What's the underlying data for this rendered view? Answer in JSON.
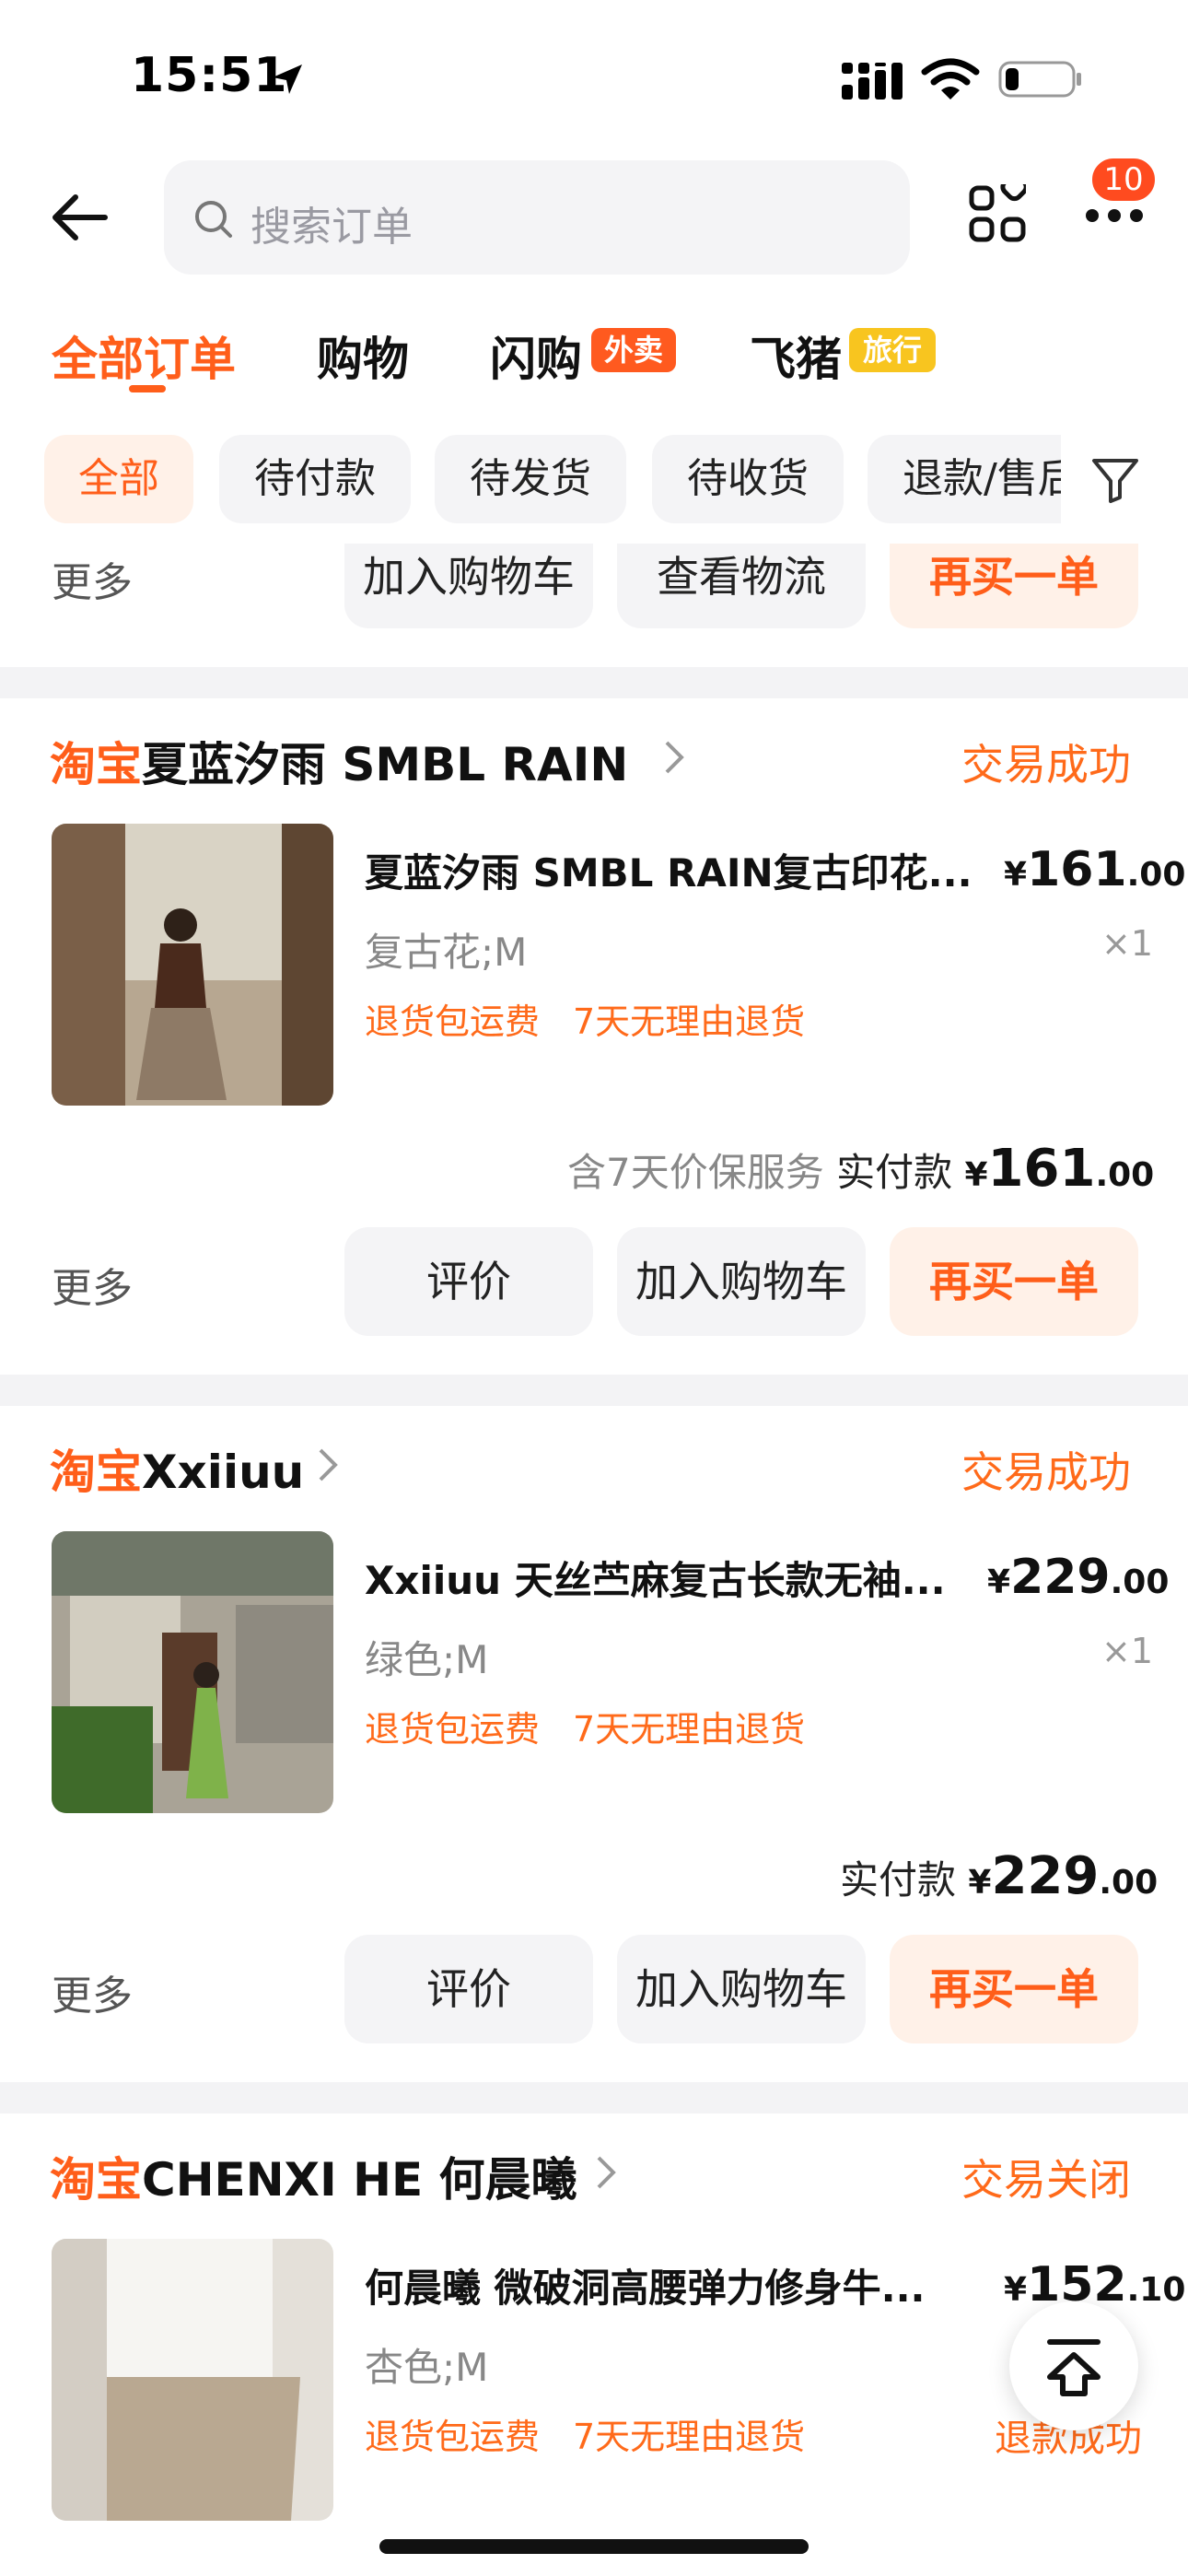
{
  "status_bar": {
    "time": "15:51"
  },
  "header": {
    "search_placeholder": "搜索订单",
    "badge_count": "10"
  },
  "tabs": [
    {
      "label": "全部订单",
      "active": true
    },
    {
      "label": "购物"
    },
    {
      "label": "闪购",
      "tag": "外卖"
    },
    {
      "label": "飞猪",
      "tag": "旅行"
    }
  ],
  "filters": [
    "全部",
    "待付款",
    "待发货",
    "待收货",
    "退款/售后"
  ],
  "prev_card": {
    "more": "更多",
    "buttons": [
      "加入购物车",
      "查看物流",
      "再买一单"
    ]
  },
  "orders": [
    {
      "platform": "淘宝",
      "shop": "夏蓝汐雨 SMBL RAIN",
      "status": "交易成功",
      "title": "夏蓝汐雨 SMBL RAIN复古印花...",
      "price_symbol": "¥",
      "price_int": "161",
      "price_dec": ".00",
      "variant": "复古花;M",
      "qty": "×1",
      "guarantees": [
        "退货包运费",
        "7天无理由退货"
      ],
      "extra_service": "含7天价保服务",
      "paid_label": "实付款",
      "paid_int": "161",
      "paid_dec": ".00",
      "more": "更多",
      "buttons": [
        "评价",
        "加入购物车",
        "再买一单"
      ],
      "thumb_colors": [
        "#7a5f48",
        "#c9b9a3",
        "#5a3a2a"
      ]
    },
    {
      "platform": "淘宝",
      "shop": "Xxiiuu",
      "status": "交易成功",
      "title": "Xxiiuu 天丝苎麻复古长款无袖...",
      "price_symbol": "¥",
      "price_int": "229",
      "price_dec": ".00",
      "variant": "绿色;M",
      "qty": "×1",
      "guarantees": [
        "退货包运费",
        "7天无理由退货"
      ],
      "paid_label": "实付款",
      "paid_int": "229",
      "paid_dec": ".00",
      "more": "更多",
      "buttons": [
        "评价",
        "加入购物车",
        "再买一单"
      ],
      "thumb_colors": [
        "#6f7768",
        "#b7b2a4",
        "#7fb24a"
      ]
    },
    {
      "platform": "淘宝",
      "shop": "CHENXI HE 何晨曦",
      "status": "交易关闭",
      "title": "何晨曦 微破洞高腰弹力修身牛...",
      "price_symbol": "¥",
      "price_int": "152",
      "price_dec": ".10",
      "variant": "杏色;M",
      "guarantees": [
        "退货包运费",
        "7天无理由退货"
      ],
      "refund_status": "退款成功",
      "thumb_colors": [
        "#d9d4cc",
        "#f2f0ec",
        "#b9a891"
      ]
    }
  ],
  "colors": {
    "accent": "#ff5e1a",
    "chip_bg": "#f4f4f6",
    "orange_btn_bg": "#fff1e8"
  }
}
